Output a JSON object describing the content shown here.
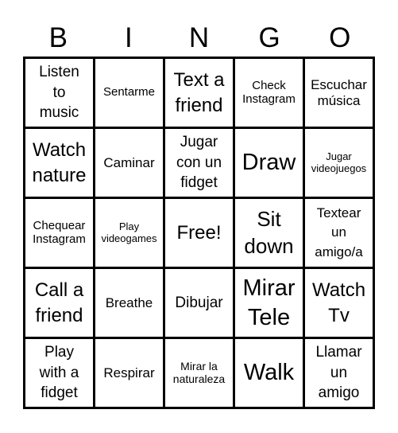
{
  "header": {
    "letters": [
      "B",
      "I",
      "N",
      "G",
      "O"
    ]
  },
  "grid": {
    "rows": [
      [
        "Listen to music",
        "Sentarme",
        "Text a friend",
        "Check Instagram",
        "Escuchar música"
      ],
      [
        "Watch nature",
        "Caminar",
        "Jugar con un fidget",
        "Draw",
        "Jugar videojuegos"
      ],
      [
        "Chequear Instagram",
        "Play videogames",
        "Free!",
        "Sit down",
        "Textear un amigo/a"
      ],
      [
        "Call a friend",
        "Breathe",
        "Dibujar",
        "Mirar Tele",
        "Watch Tv"
      ],
      [
        "Play with a fidget",
        "Respirar",
        "Mirar la naturaleza",
        "Walk",
        "Llamar un amigo"
      ]
    ]
  }
}
